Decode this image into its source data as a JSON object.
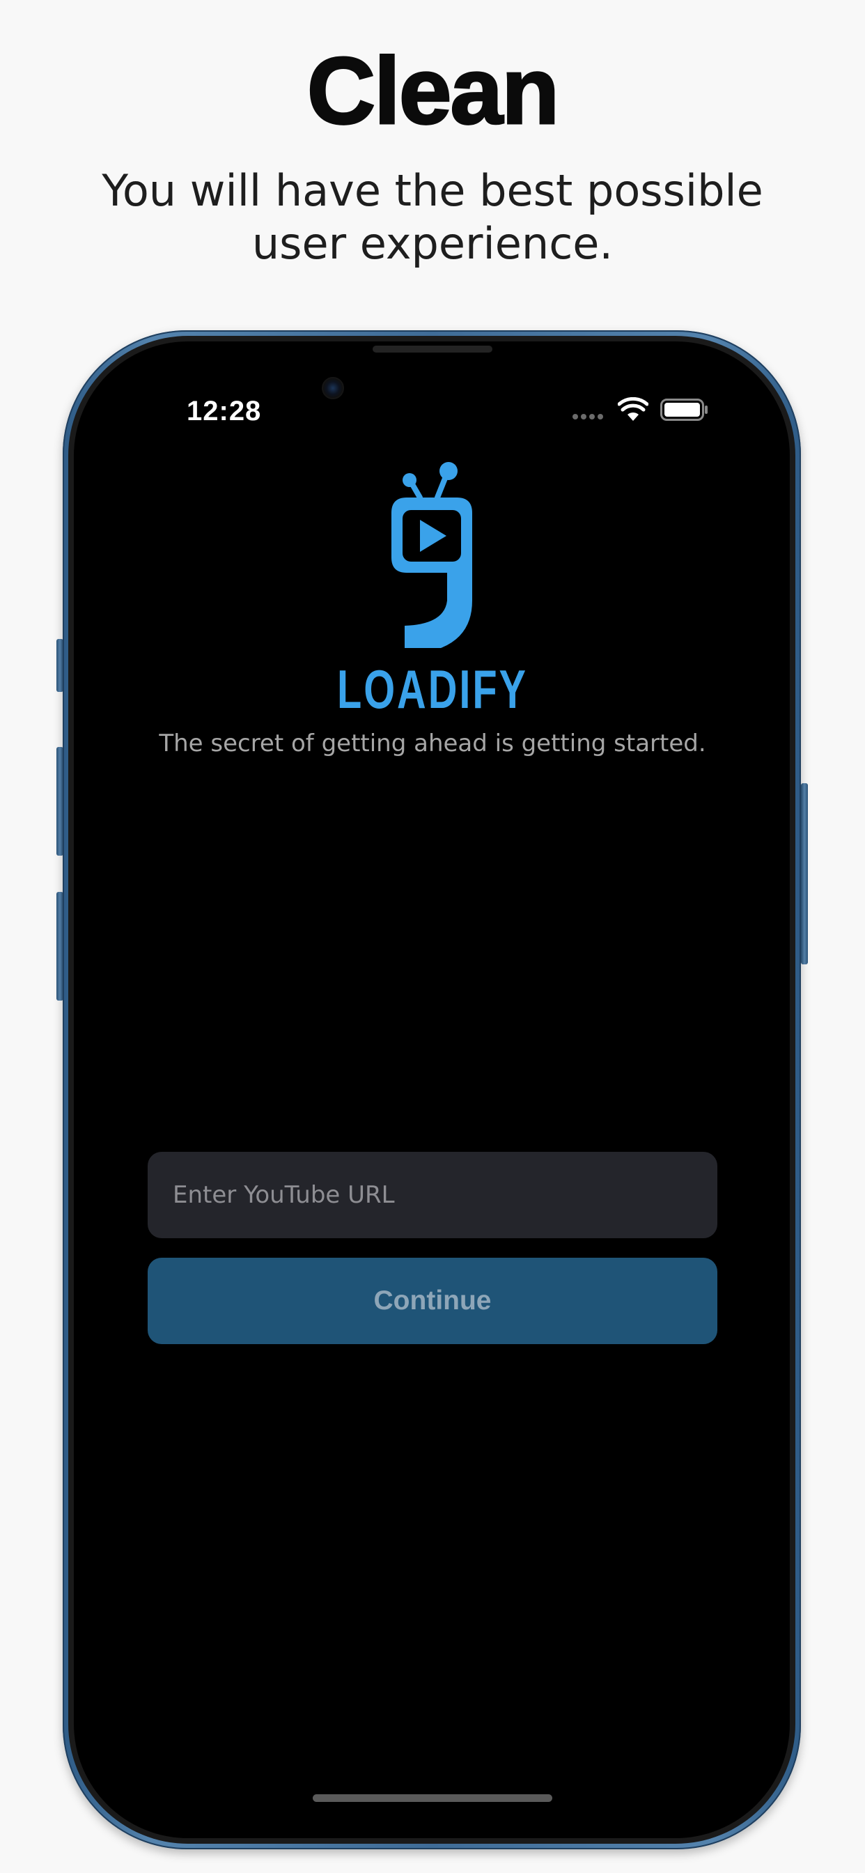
{
  "promo": {
    "headline": "Clean",
    "subline_line1": "You will have the best possible",
    "subline_line2": "user experience."
  },
  "status_bar": {
    "time": "12:28",
    "icons": [
      "cellular-dots-icon",
      "wifi-icon",
      "battery-icon"
    ]
  },
  "app": {
    "logo_icon": "tv-play-logo-icon",
    "name": "LOADIFY",
    "tagline": "The secret of getting ahead is getting started.",
    "url_input": {
      "value": "",
      "placeholder": "Enter YouTube URL"
    },
    "continue_label": "Continue"
  },
  "colors": {
    "accent": "#3aa2ea",
    "button_bg": "#1f5477",
    "button_text": "#8ea6b8",
    "input_bg": "#24252b",
    "screen_bg": "#000000",
    "frame": "#4a78a3",
    "page_bg": "#f8f8f8"
  }
}
